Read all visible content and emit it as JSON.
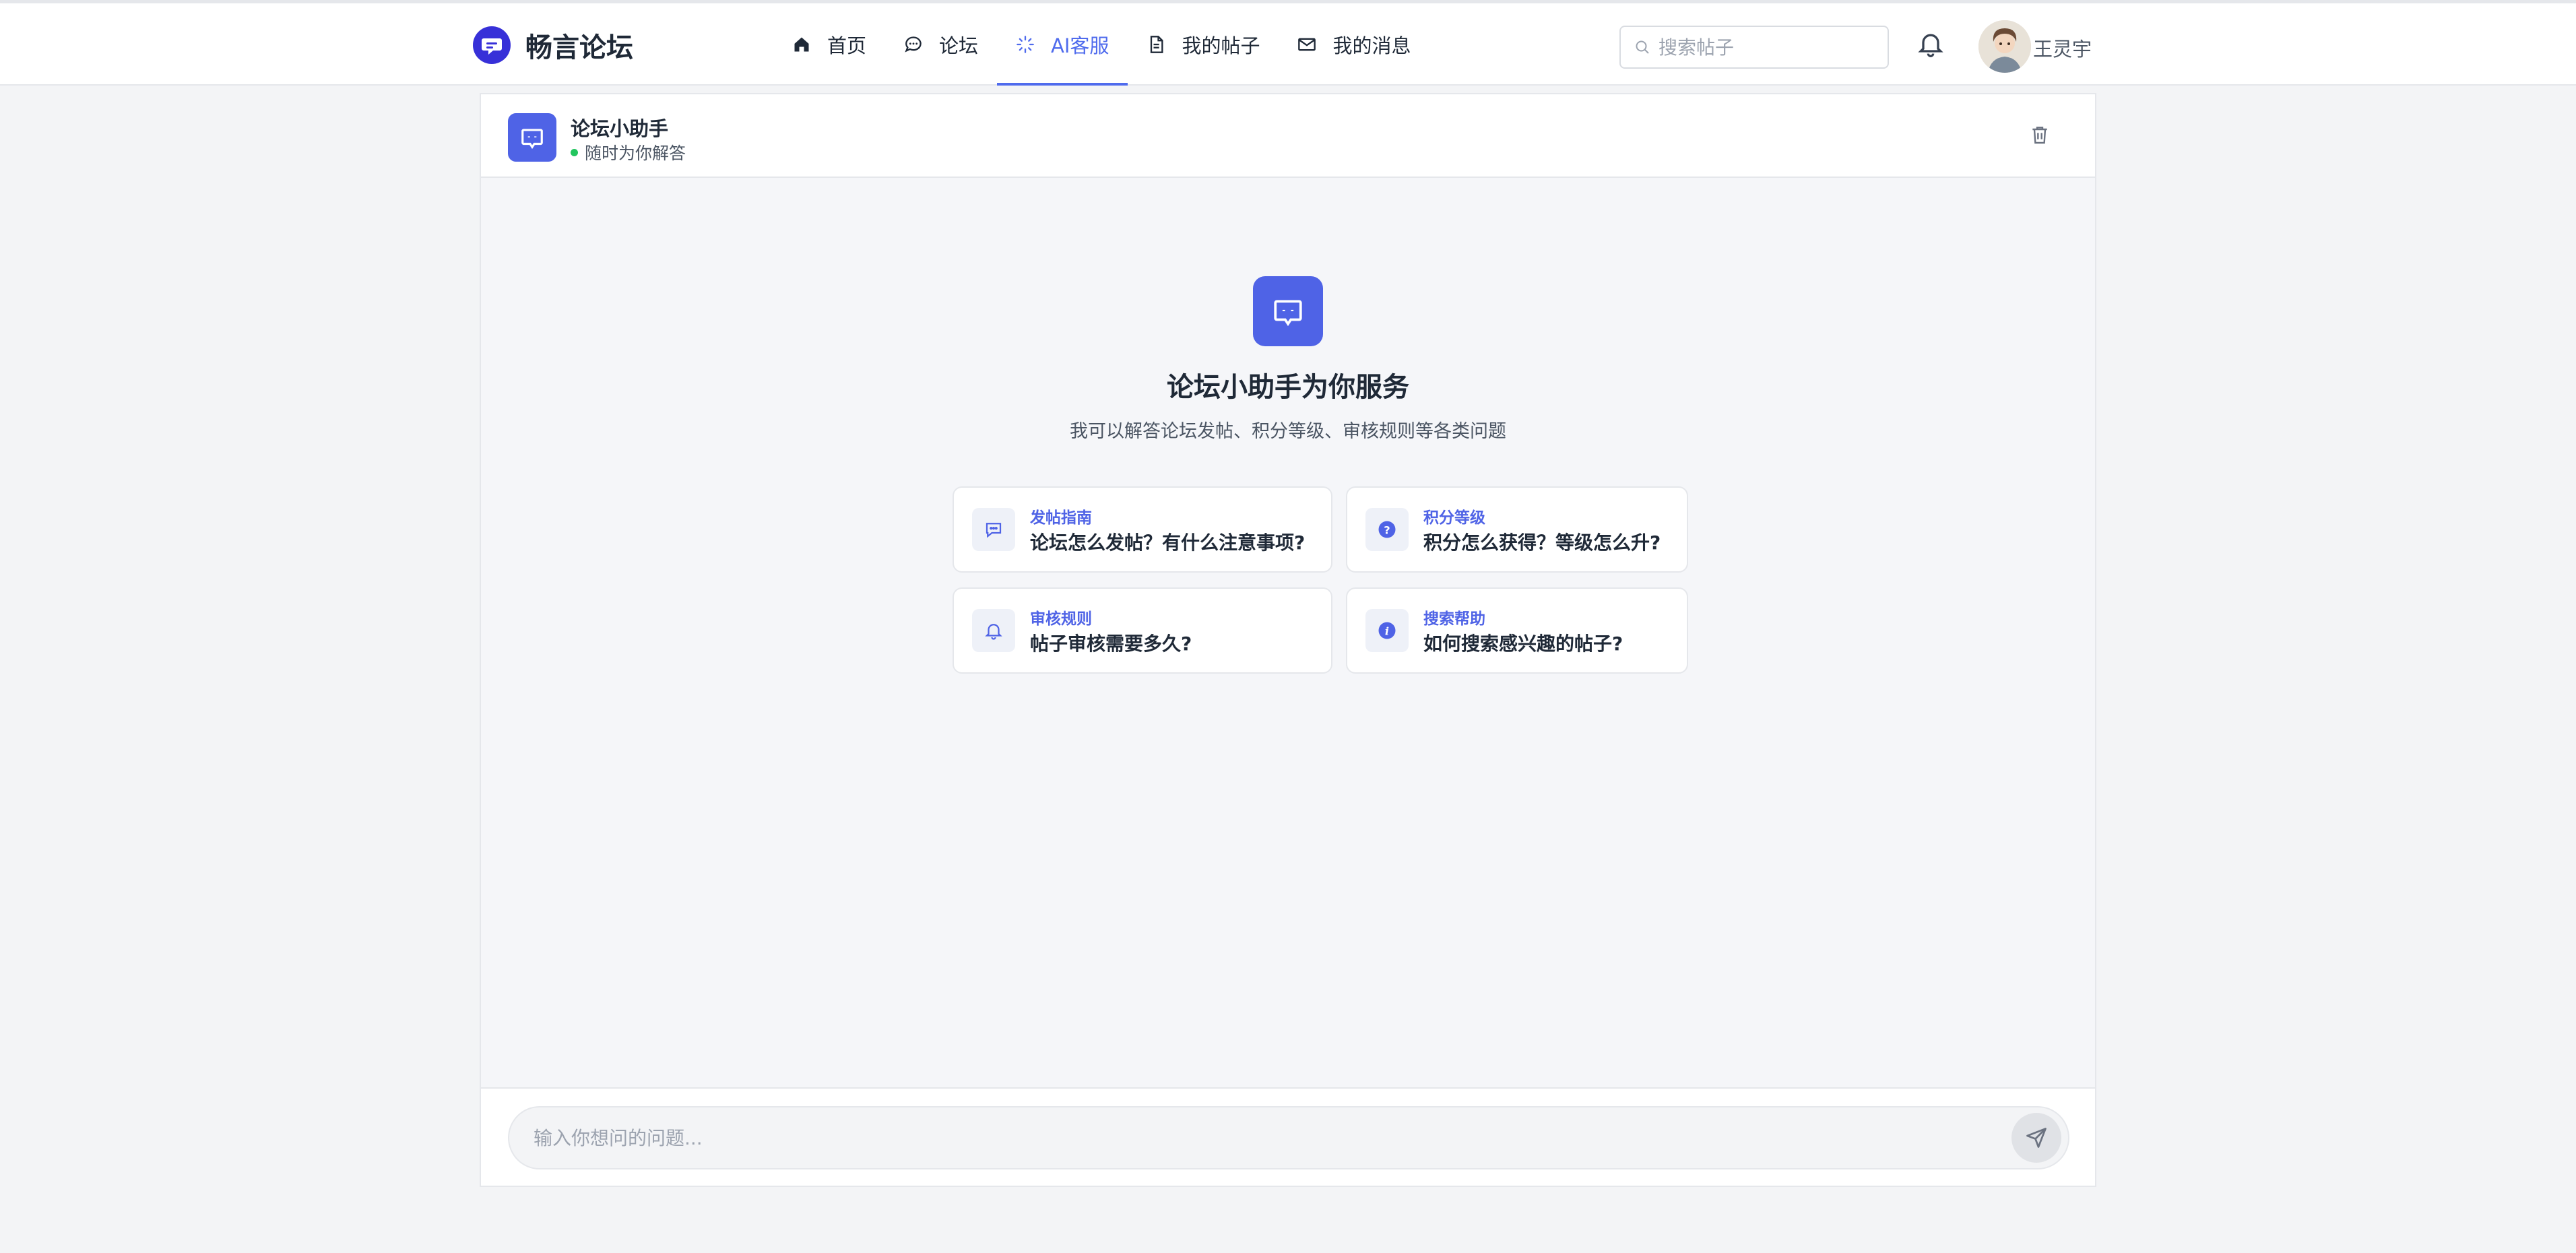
{
  "app": {
    "name": "畅言论坛"
  },
  "nav": {
    "items": [
      {
        "label": "首页",
        "icon": "home-icon",
        "active": false
      },
      {
        "label": "论坛",
        "icon": "chat-bubble-icon",
        "active": false
      },
      {
        "label": "AI客服",
        "icon": "sparkle-icon",
        "active": true
      },
      {
        "label": "我的帖子",
        "icon": "document-icon",
        "active": false
      },
      {
        "label": "我的消息",
        "icon": "mail-icon",
        "active": false
      }
    ]
  },
  "search": {
    "placeholder": "搜索帖子",
    "value": ""
  },
  "user": {
    "name": "王灵宇"
  },
  "chat": {
    "bot_name": "论坛小助手",
    "bot_status": "随时为你解答",
    "welcome_title": "论坛小助手为你服务",
    "welcome_subtitle": "我可以解答论坛发帖、积分等级、审核规则等各类问题",
    "suggestions": [
      {
        "category": "发帖指南",
        "question": "论坛怎么发帖？有什么注意事项?",
        "icon": "message-icon"
      },
      {
        "category": "积分等级",
        "question": "积分怎么获得？等级怎么升?",
        "icon": "help-circle-icon"
      },
      {
        "category": "审核规则",
        "question": "帖子审核需要多久?",
        "icon": "bell-icon"
      },
      {
        "category": "搜索帮助",
        "question": "如何搜索感兴趣的帖子?",
        "icon": "info-icon"
      }
    ],
    "input_placeholder": "输入你想问的问题...",
    "input_value": ""
  },
  "colors": {
    "accent": "#4f63e6",
    "brand": "#3730d8",
    "active_nav": "#4f6bed",
    "status_online": "#22c55e",
    "page_bg": "#f3f4f6"
  }
}
